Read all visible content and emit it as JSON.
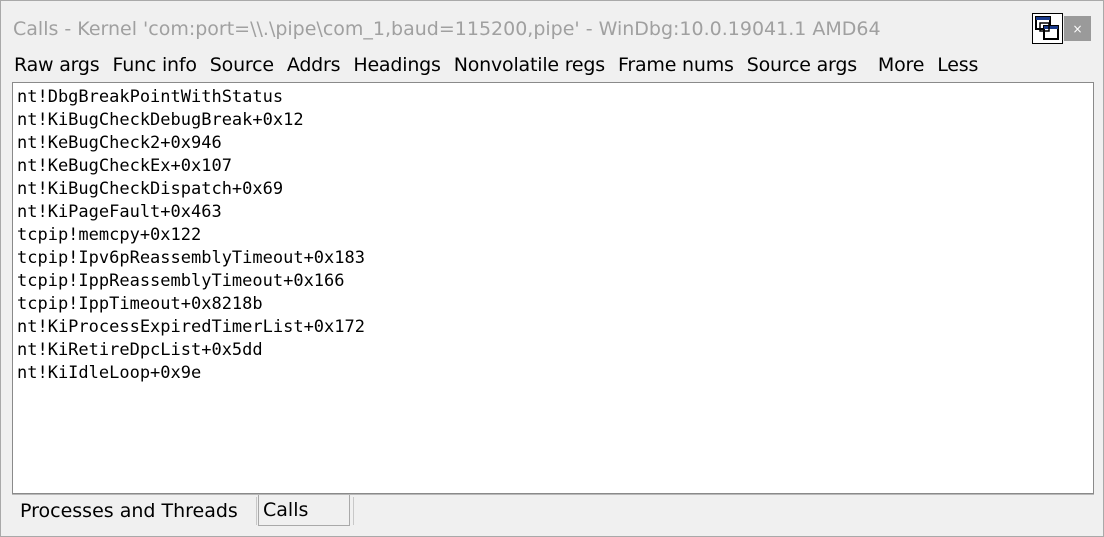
{
  "window": {
    "title": "Calls - Kernel 'com:port=\\\\.\\pipe\\com_1,baud=115200,pipe' - WinDbg:10.0.19041.1 AMD64",
    "close_label": "×"
  },
  "toolbar": {
    "buttons": [
      "Raw args",
      "Func info",
      "Source",
      "Addrs",
      "Headings",
      "Nonvolatile regs",
      "Frame nums",
      "Source args",
      "More",
      "Less"
    ]
  },
  "stack": [
    "nt!DbgBreakPointWithStatus",
    "nt!KiBugCheckDebugBreak+0x12",
    "nt!KeBugCheck2+0x946",
    "nt!KeBugCheckEx+0x107",
    "nt!KiBugCheckDispatch+0x69",
    "nt!KiPageFault+0x463",
    "tcpip!memcpy+0x122",
    "tcpip!Ipv6pReassemblyTimeout+0x183",
    "tcpip!IppReassemblyTimeout+0x166",
    "tcpip!IppTimeout+0x8218b",
    "nt!KiProcessExpiredTimerList+0x172",
    "nt!KiRetireDpcList+0x5dd",
    "nt!KiIdleLoop+0x9e"
  ],
  "tabs": [
    "Processes and Threads",
    "Calls"
  ],
  "icons": {
    "dock": "dock-window-icon",
    "close": "close-icon"
  }
}
